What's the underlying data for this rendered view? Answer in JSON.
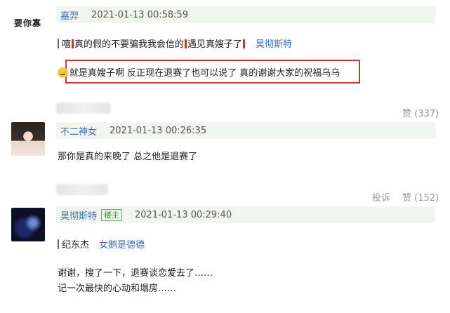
{
  "posts": [
    {
      "left_user": "要你寡",
      "author": "嘉羿",
      "time": "2021-01-13 00:58:59",
      "quote_text_1": "嘻",
      "quote_text_2": "真的假的不要骗我我会信的",
      "quote_text_3": "遇见真嫂子了",
      "quote_reply_user": "昊彻斯特",
      "highlight_text": "就是真嫂子啊 反正现在退赛了也可以说了 真的谢谢大家的祝福乌乌",
      "like_label": "赞 (337)"
    },
    {
      "author": "不二神女",
      "time": "2021-01-13 00:26:35",
      "text": "那你是真的来晚了 总之他是退赛了",
      "report_label": "投诉",
      "like_label": "赞 (152)"
    },
    {
      "author": "昊彻斯特",
      "badge": "楼主",
      "time": "2021-01-13 00:29:40",
      "quote_user": "纪东杰",
      "quote_reply_user": "女鹅是德德",
      "text_1": "谢谢，搜了一下，退赛谈恋爱去了……",
      "text_2": "记一次最快的心动和塌房……"
    }
  ],
  "colors": {
    "accent_link": "#3d6fb5",
    "highlight_border": "#d33434",
    "meta_bar": "#f2f5ef"
  }
}
